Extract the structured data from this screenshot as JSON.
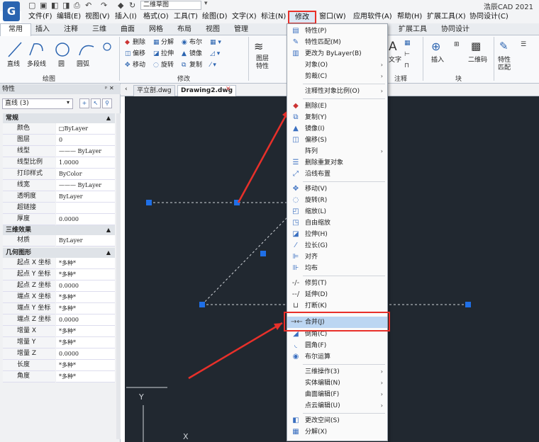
{
  "title_bar": {
    "app_title": "浩辰CAD 2021",
    "workspace": "二维草图",
    "logo": "G"
  },
  "menu_bar": [
    "文件(F)",
    "编辑(E)",
    "视图(V)",
    "插入(I)",
    "格式(O)",
    "工具(T)",
    "绘图(D)",
    "文字(X)",
    "标注(N)",
    "修改(M)",
    "窗口(W)",
    "应用软件(A)",
    "帮助(H)",
    "扩展工具(X)",
    "协同设计(C)"
  ],
  "ribbon_tabs": [
    "常用",
    "插入",
    "注释",
    "三维",
    "曲面",
    "网格",
    "布局",
    "视图",
    "管理",
    "",
    "",
    "",
    "扩展工具",
    "协同设计"
  ],
  "ribbon": {
    "draw": [
      "直线",
      "多段线",
      "圆",
      "圆弧"
    ],
    "draw_group": "绘图",
    "modify_rows": [
      [
        "删除",
        "分解",
        "布尔"
      ],
      [
        "偏移",
        "拉伸",
        "镜像"
      ],
      [
        "移动",
        "旋转",
        "复制"
      ]
    ],
    "modify_group": "修改",
    "layer_label": "图层特性",
    "text_label": "文字",
    "note_group": "注释",
    "insert_label": "插入",
    "qr_label": "二维码",
    "block_group": "块",
    "match_label": "特性匹配"
  },
  "properties_panel": {
    "title": "特性",
    "selection": "直线 (3)",
    "sections": [
      {
        "name": "常规",
        "rows": [
          [
            "颜色",
            "□ByLayer"
          ],
          [
            "图层",
            "0"
          ],
          [
            "线型",
            "——— ByLayer"
          ],
          [
            "线型比例",
            "1.0000"
          ],
          [
            "打印样式",
            "ByColor"
          ],
          [
            "线宽",
            "——— ByLayer"
          ],
          [
            "透明度",
            "ByLayer"
          ],
          [
            "超链接",
            ""
          ],
          [
            "厚度",
            "0.0000"
          ]
        ]
      },
      {
        "name": "三维效果",
        "rows": [
          [
            "材质",
            "ByLayer"
          ]
        ]
      },
      {
        "name": "几何图形",
        "rows": [
          [
            "起点 X 坐标",
            "*多种*"
          ],
          [
            "起点 Y 坐标",
            "*多种*"
          ],
          [
            "起点 Z 坐标",
            "0.0000"
          ],
          [
            "端点 X 坐标",
            "*多种*"
          ],
          [
            "端点 Y 坐标",
            "*多种*"
          ],
          [
            "端点 Z 坐标",
            "0.0000"
          ],
          [
            "增量 X",
            "*多种*"
          ],
          [
            "增量 Y",
            "*多种*"
          ],
          [
            "增量 Z",
            "0.0000"
          ],
          [
            "长度",
            "*多种*"
          ],
          [
            "角度",
            "*多种*"
          ]
        ]
      }
    ]
  },
  "doc_tabs": [
    "平立剖.dwg",
    "Drawing2.dwg"
  ],
  "modify_menu": {
    "label": "修改(M)",
    "items": [
      {
        "label": "特性(P)",
        "icon": "properties-icon"
      },
      {
        "label": "特性匹配(M)",
        "icon": "match-brush-icon"
      },
      {
        "label": "更改为 ByLayer(B)",
        "icon": "bylayer-icon"
      },
      {
        "label": "对象(O)",
        "sub": true
      },
      {
        "label": "剪裁(C)",
        "sub": true
      },
      {
        "sep": true
      },
      {
        "label": "注释性对象比例(O)",
        "sub": true
      },
      {
        "sep": true
      },
      {
        "label": "删除(E)",
        "icon": "eraser-icon"
      },
      {
        "label": "复制(Y)",
        "icon": "copy-icon"
      },
      {
        "label": "镜像(I)",
        "icon": "mirror-icon"
      },
      {
        "label": "偏移(S)",
        "icon": "offset-icon"
      },
      {
        "label": "阵列",
        "sub": true
      },
      {
        "label": "删除重复对象",
        "icon": "overkill-icon"
      },
      {
        "label": "沿线布置",
        "icon": "measure-icon"
      },
      {
        "sep": true
      },
      {
        "label": "移动(V)",
        "icon": "move-icon"
      },
      {
        "label": "旋转(R)",
        "icon": "rotate-icon"
      },
      {
        "label": "缩放(L)",
        "icon": "scale-icon"
      },
      {
        "label": "自由缩放",
        "icon": "free-scale-icon"
      },
      {
        "label": "拉伸(H)",
        "icon": "stretch-icon"
      },
      {
        "label": "拉长(G)",
        "icon": "lengthen-icon"
      },
      {
        "label": "对齐",
        "icon": "align-icon"
      },
      {
        "label": "均布",
        "icon": "distribute-icon"
      },
      {
        "sep": true
      },
      {
        "label": "修剪(T)",
        "icon": "trim-icon"
      },
      {
        "label": "延伸(D)",
        "icon": "extend-icon"
      },
      {
        "label": "打断(K)",
        "icon": "break-icon"
      },
      {
        "label": "合并(J)",
        "icon": "join-icon",
        "highlight": true
      },
      {
        "label": "倒角(C)",
        "icon": "chamfer-icon"
      },
      {
        "label": "圆角(F)",
        "icon": "fillet-icon"
      },
      {
        "label": "布尔运算",
        "icon": "boolean-icon"
      },
      {
        "sep": true
      },
      {
        "label": "三维操作(3)",
        "sub": true
      },
      {
        "label": "实体编辑(N)",
        "sub": true
      },
      {
        "label": "曲面编辑(F)",
        "sub": true
      },
      {
        "label": "点云编辑(U)",
        "sub": true
      },
      {
        "sep": true
      },
      {
        "label": "更改空间(S)",
        "icon": "change-space-icon"
      },
      {
        "label": "分解(X)",
        "icon": "explode-icon"
      }
    ]
  },
  "canvas": {
    "ucs_y": "Y",
    "ucs_x": "X",
    "accent": "#e8302a",
    "grip": "#1f6fe6"
  }
}
